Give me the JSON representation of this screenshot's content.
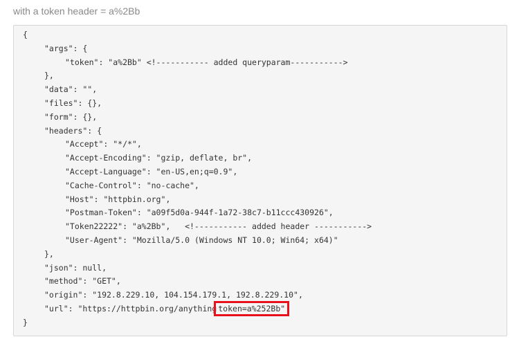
{
  "intro_text": "with a token header = a%2Bb",
  "code_lines": [
    {
      "indent": 0,
      "text": "{"
    },
    {
      "indent": 1,
      "text": "\"args\": {"
    },
    {
      "indent": 2,
      "text": "\"token\": \"a%2Bb\" <!----------- added queryparam----------->"
    },
    {
      "indent": 1,
      "text": "},"
    },
    {
      "indent": 1,
      "text": "\"data\": \"\","
    },
    {
      "indent": 1,
      "text": "\"files\": {},"
    },
    {
      "indent": 1,
      "text": "\"form\": {},"
    },
    {
      "indent": 1,
      "text": "\"headers\": {"
    },
    {
      "indent": 2,
      "text": "\"Accept\": \"*/*\","
    },
    {
      "indent": 2,
      "text": "\"Accept-Encoding\": \"gzip, deflate, br\","
    },
    {
      "indent": 2,
      "text": "\"Accept-Language\": \"en-US,en;q=0.9\","
    },
    {
      "indent": 2,
      "text": "\"Cache-Control\": \"no-cache\","
    },
    {
      "indent": 2,
      "text": "\"Host\": \"httpbin.org\","
    },
    {
      "indent": 2,
      "text": "\"Postman-Token\": \"a09f5d0a-944f-1a72-38c7-b11ccc430926\","
    },
    {
      "indent": 2,
      "text": "\"Token22222\": \"a%2Bb\",   <!----------- added header ----------->"
    },
    {
      "indent": 2,
      "text": "\"User-Agent\": \"Mozilla/5.0 (Windows NT 10.0; Win64; x64)\""
    },
    {
      "indent": 1,
      "text": "},"
    },
    {
      "indent": 1,
      "text": "\"json\": null,"
    },
    {
      "indent": 1,
      "text": "\"method\": \"GET\","
    },
    {
      "indent": 1,
      "text": "\"origin\": \"192.8.229.10, 104.154.179.1, 192.8.229.10\","
    },
    {
      "indent": 1,
      "text": "\"url\": \"https://httpbin.org/anything",
      "highlight": "token=a%252Bb\""
    },
    {
      "indent": 0,
      "text": "}"
    }
  ],
  "highlight_color": "#e8101a"
}
